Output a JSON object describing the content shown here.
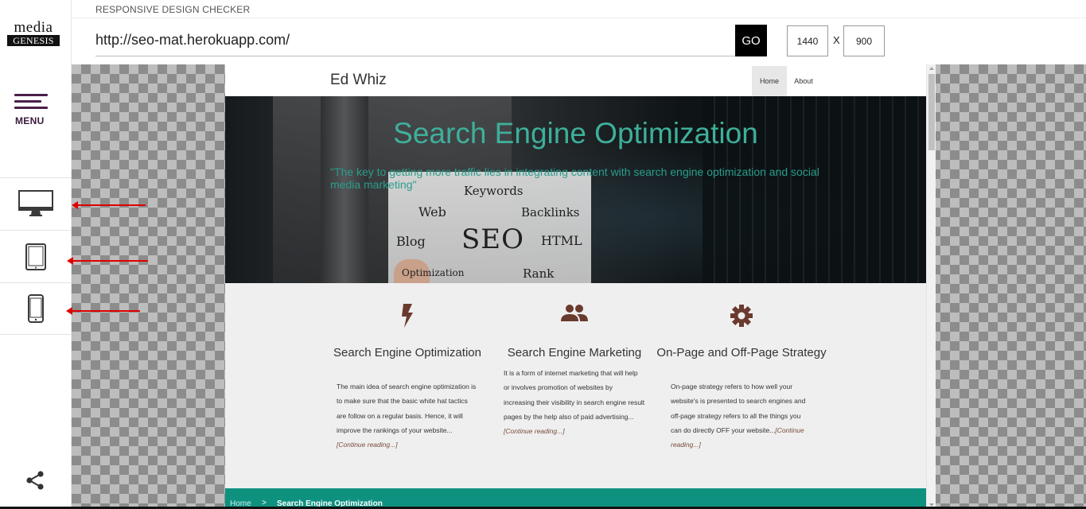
{
  "app": {
    "title": "RESPONSIVE DESIGN CHECKER",
    "logo_top": "media",
    "logo_bottom": "GENESIS"
  },
  "sidebar": {
    "menu_label": "MENU",
    "devices": [
      {
        "icon": "desktop-icon"
      },
      {
        "icon": "tablet-icon"
      },
      {
        "icon": "phone-icon"
      }
    ],
    "share_icon": "share-icon"
  },
  "toolbar": {
    "url_value": "http://seo-mat.herokuapp.com/",
    "go_label": "GO",
    "width_value": "1440",
    "separator": "X",
    "height_value": "900"
  },
  "site": {
    "brand": "Ed Whiz",
    "nav": {
      "home": "Home",
      "about": "About"
    },
    "hero": {
      "title": "Search Engine Optimization",
      "quote": "\"The key to getting more traffic lies in integrating content with search engine optimization and social media marketing\"",
      "wordcloud": {
        "seo": "SEO",
        "keywords": "Keywords",
        "web": "Web",
        "backlinks": "Backlinks",
        "blog": "Blog",
        "html": "HTML",
        "optimization": "Optimization",
        "rank": "Rank"
      }
    },
    "features": [
      {
        "icon": "bolt-icon",
        "title": "Search Engine Optimization",
        "body": "The main idea of search engine optimization is to make sure that the basic white hat tactics are follow on a regular basis. Hence, it will improve the rankings of your website...",
        "more": "[Continue reading...]"
      },
      {
        "icon": "people-icon",
        "title": "Search Engine Marketing",
        "body": "It is a form of internet marketing that will help or involves promotion of websites by increasing their visibility in search engine result pages by the help also of paid advertising...",
        "more": "[Continue reading...]"
      },
      {
        "icon": "gear-icon",
        "title": "On-Page and Off-Page Strategy",
        "body": "On-page strategy refers to how well your website's is presented to search engines and off-page strategy refers to all the things you can do directly OFF your website...",
        "more": "[Continue reading...]"
      }
    ],
    "breadcrumb": {
      "home": "Home",
      "separator": ">",
      "current": "Search Engine Optimization"
    }
  },
  "colors": {
    "accent": "#3eaf9a",
    "menu": "#4a1f4a",
    "icon_brown": "#6b3a2e",
    "breadcrumb_bg": "#0f9180",
    "annotation_arrow": "#e00000"
  }
}
